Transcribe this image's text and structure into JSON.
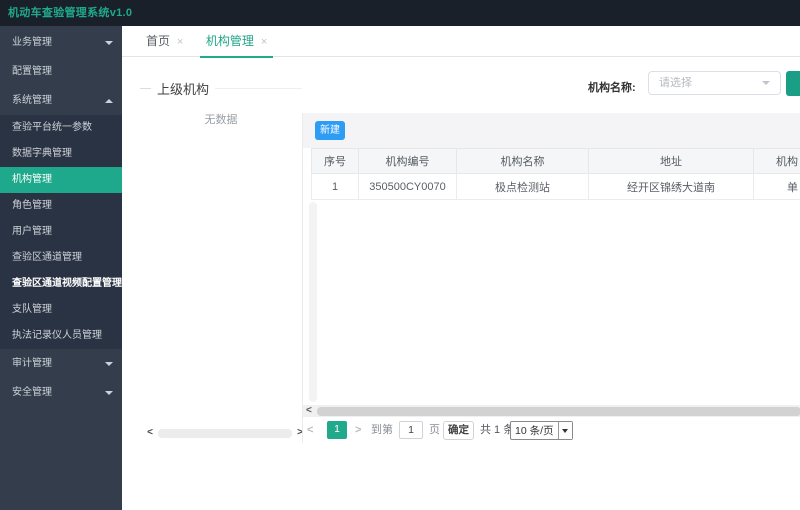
{
  "app": {
    "title": "机动车查验管理系统v1.0"
  },
  "colors": {
    "accent_teal": "#1fa98c",
    "primary_blue": "#2d9cf4",
    "topbar_bg": "#1a202a",
    "sidebar_bg": "#343d4c",
    "sidebar_submenu_bg": "#2a3343"
  },
  "sidebar": {
    "items": [
      {
        "label": "业务管理",
        "type": "group",
        "caret": "down"
      },
      {
        "label": "配置管理",
        "type": "group"
      },
      {
        "label": "系统管理",
        "type": "group",
        "caret": "up"
      },
      {
        "label": "查验平台统一参数",
        "type": "sub"
      },
      {
        "label": "数据字典管理",
        "type": "sub"
      },
      {
        "label": "机构管理",
        "type": "sub",
        "active": true
      },
      {
        "label": "角色管理",
        "type": "sub"
      },
      {
        "label": "用户管理",
        "type": "sub"
      },
      {
        "label": "查验区通道管理",
        "type": "sub"
      },
      {
        "label": "查验区通道视频配置管理",
        "type": "sub",
        "highlighted": true
      },
      {
        "label": "支队管理",
        "type": "sub"
      },
      {
        "label": "执法记录仪人员管理",
        "type": "sub"
      },
      {
        "label": "审计管理",
        "type": "group",
        "caret": "down"
      },
      {
        "label": "安全管理",
        "type": "group",
        "caret": "down"
      }
    ]
  },
  "tabs": [
    {
      "label": "首页",
      "close": "×"
    },
    {
      "label": "机构管理",
      "close": "×",
      "active": true
    }
  ],
  "filter": {
    "label": "机构名称:",
    "select_placeholder": "请选择"
  },
  "tree": {
    "legend": "上级机构",
    "empty_text": "无数据"
  },
  "toolbar": {
    "new_button": "新建"
  },
  "table": {
    "columns": [
      "序号",
      "机构编号",
      "机构名称",
      "地址",
      "机构"
    ],
    "rows": [
      {
        "seq": "1",
        "code": "350500CY0070",
        "name": "极点检测站",
        "address": "经开区锦绣大道南",
        "type": "单"
      }
    ]
  },
  "pagination": {
    "prev": "<",
    "page": "1",
    "next": ">",
    "goto_label": "到第",
    "goto_value": "1",
    "goto_suffix": "页",
    "confirm": "确定",
    "total": "共 1 条",
    "page_size": "10 条/页"
  },
  "scrollbars": {
    "left_arrow": "<",
    "right_arrow": ">"
  }
}
